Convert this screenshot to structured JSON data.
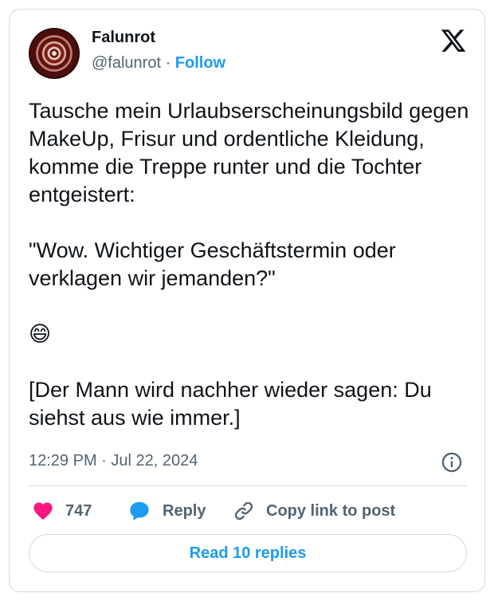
{
  "author": {
    "name": "Falunrot",
    "handle": "@falunrot",
    "separator": " · ",
    "follow_label": "Follow"
  },
  "tweet": {
    "text": "Tausche mein Urlaubserscheinungsbild gegen MakeUp, Frisur und ordentliche Kleidung, komme die Treppe runter und die Tochter entgeistert:\n\n\"Wow. Wichtiger Geschäftstermin oder verklagen wir jemanden?\"\n\n😄\n\n[Der Mann wird nachher wieder sagen: Du siehst aus wie immer.]",
    "timestamp": "12:29 PM · Jul 22, 2024"
  },
  "actions": {
    "like_count": "747",
    "reply_label": "Reply",
    "copy_label": "Copy link to post"
  },
  "footer": {
    "read_replies_label": "Read 10 replies"
  },
  "colors": {
    "accent": "#1d9bf0",
    "like": "#f91880",
    "muted_text": "#536471",
    "border": "#cfd9de"
  },
  "icons": [
    "x-logo-icon",
    "info-icon",
    "heart-icon",
    "reply-bubble-icon",
    "link-icon"
  ]
}
